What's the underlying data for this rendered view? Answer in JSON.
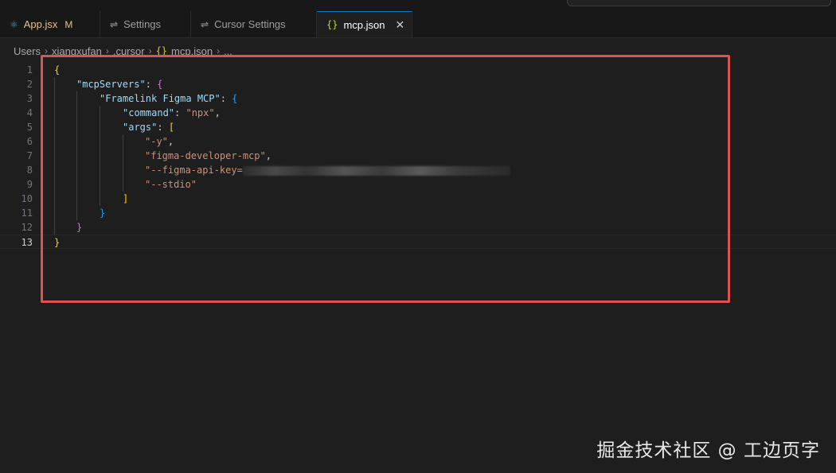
{
  "tabs": [
    {
      "label": "App.jsx",
      "badge": "M",
      "icon": "react-icon"
    },
    {
      "label": "Settings",
      "icon": "settings-icon"
    },
    {
      "label": "Cursor Settings",
      "icon": "settings-icon"
    },
    {
      "label": "mcp.json",
      "icon": "json-icon",
      "active": true,
      "close": "✕"
    }
  ],
  "breadcrumb": {
    "parts": [
      "Users",
      "xiangxufan",
      ".cursor",
      "mcp.json",
      "..."
    ],
    "json_glyph": "{}"
  },
  "editor": {
    "line_numbers": [
      "1",
      "2",
      "3",
      "4",
      "5",
      "6",
      "7",
      "8",
      "9",
      "10",
      "11",
      "12",
      "13"
    ],
    "lines": {
      "l1_open": "{",
      "l2_key": "\"mcpServers\"",
      "l2_colon": ": ",
      "l2_brace": "{",
      "l3_key": "\"Framelink Figma MCP\"",
      "l3_colon": ": ",
      "l3_brace": "{",
      "l4_key": "\"command\"",
      "l4_colon": ": ",
      "l4_val": "\"npx\"",
      "l4_comma": ",",
      "l5_key": "\"args\"",
      "l5_colon": ": ",
      "l5_bracket": "[",
      "l6_val": "\"-y\"",
      "l6_comma": ",",
      "l7_val": "\"figma-developer-mcp\"",
      "l7_comma": ",",
      "l8_val": "\"--figma-api-key=",
      "l9_val": "\"--stdio\"",
      "l10_close": "]",
      "l11_close": "}",
      "l12_close": "}",
      "l13_close": "}"
    }
  },
  "colors": {
    "highlight_border": "#e05252",
    "tab_accent": "#0078d4",
    "key": "#9cdcfe",
    "string": "#ce9178"
  },
  "watermark": "掘金技术社区 @ 工边页字"
}
